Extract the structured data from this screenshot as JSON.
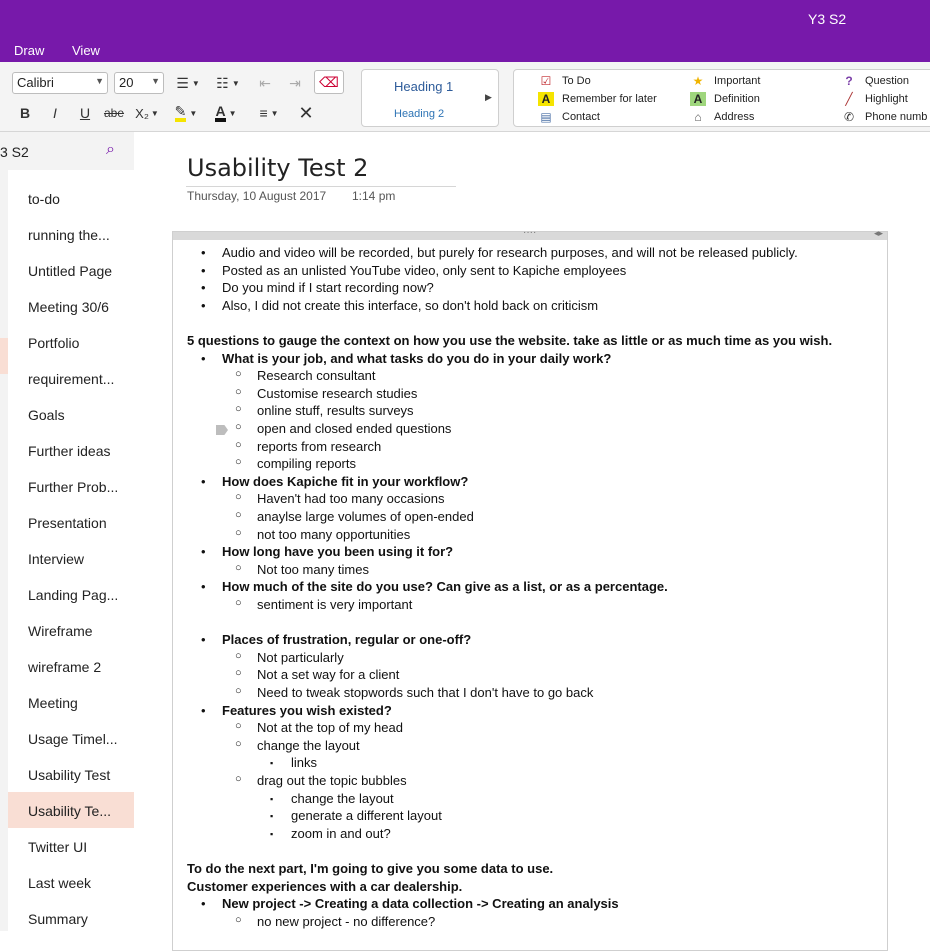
{
  "window": {
    "title": "Y3 S2"
  },
  "menu": {
    "draw": "Draw",
    "view": "View"
  },
  "ribbon": {
    "font_name": "Calibri",
    "font_size": "20",
    "bold": "B",
    "italic": "I",
    "underline": "U",
    "strike": "abe",
    "subscript": "X₂",
    "highlight_color": "#f5e400",
    "font_color": "#111111",
    "styles": {
      "heading1": "Heading 1",
      "heading2": "Heading 2"
    },
    "tags": {
      "todo": "To Do",
      "remember": "Remember for later",
      "contact": "Contact",
      "important": "Important",
      "definition": "Definition",
      "address": "Address",
      "question": "Question",
      "highlight": "Highlight",
      "phone": "Phone numb"
    }
  },
  "sidebar": {
    "notebook": "3 S2",
    "pages": [
      "to-do",
      "running the...",
      "Untitled Page",
      "Meeting 30/6",
      "Portfolio",
      "requirement...",
      "Goals",
      "Further ideas",
      "Further Prob...",
      "Presentation",
      "Interview",
      "Landing Pag...",
      "Wireframe",
      "wireframe 2",
      "Meeting",
      "Usage Timel...",
      "Usability Test",
      "Usability Te...",
      "Twitter UI",
      "Last week",
      "Summary"
    ],
    "selected_index": 17
  },
  "page": {
    "title": "Usability Test 2",
    "date": "Thursday, 10 August 2017",
    "time": "1:14 pm",
    "lines": [
      {
        "level": 1,
        "bold": false,
        "text": "Audio and video will be recorded, but purely for research purposes, and will not be released publicly."
      },
      {
        "level": 1,
        "bold": false,
        "text": "Posted as an unlisted YouTube video, only sent to Kapiche employees"
      },
      {
        "level": 1,
        "bold": false,
        "text": "Do you mind if I start recording now?"
      },
      {
        "level": 1,
        "bold": false,
        "text": "Also, I did not create this interface, so don't hold back on criticism"
      },
      {
        "level": 0,
        "bold": false,
        "text": ""
      },
      {
        "level": 0,
        "bold": true,
        "text": "5 questions to gauge the context on how you use the website. take as little or as much time as you wish."
      },
      {
        "level": 1,
        "bold": true,
        "text": "What is your job, and what tasks do you do in your daily work?"
      },
      {
        "level": 2,
        "bold": false,
        "text": "Research consultant"
      },
      {
        "level": 2,
        "bold": false,
        "text": "Customise research studies"
      },
      {
        "level": 2,
        "bold": false,
        "text": "online stuff, results surveys"
      },
      {
        "level": 2,
        "bold": false,
        "text": "open and closed ended questions"
      },
      {
        "level": 2,
        "bold": false,
        "text": "reports from research"
      },
      {
        "level": 2,
        "bold": false,
        "text": "compiling reports"
      },
      {
        "level": 1,
        "bold": true,
        "text": "How does Kapiche fit in your workflow?"
      },
      {
        "level": 2,
        "bold": false,
        "text": "Haven't had too many occasions"
      },
      {
        "level": 2,
        "bold": false,
        "text": "anaylse large volumes of open-ended"
      },
      {
        "level": 2,
        "bold": false,
        "text": "not too many opportunities"
      },
      {
        "level": 1,
        "bold": true,
        "text": "How long have you been using it for?"
      },
      {
        "level": 2,
        "bold": false,
        "text": "Not too many times"
      },
      {
        "level": 1,
        "bold": true,
        "text": "How much of the site do you use? Can give as a list, or as a percentage."
      },
      {
        "level": 2,
        "bold": false,
        "text": "sentiment is very important"
      },
      {
        "level": 0,
        "bold": false,
        "text": ""
      },
      {
        "level": 1,
        "bold": true,
        "text": "Places of frustration, regular or one-off?"
      },
      {
        "level": 2,
        "bold": false,
        "text": "Not particularly"
      },
      {
        "level": 2,
        "bold": false,
        "text": "Not a set way for a client"
      },
      {
        "level": 2,
        "bold": false,
        "text": "Need to tweak stopwords such that I don't have to go back"
      },
      {
        "level": 1,
        "bold": true,
        "text": "Features you wish existed?"
      },
      {
        "level": 2,
        "bold": false,
        "text": "Not at the top of my head"
      },
      {
        "level": 2,
        "bold": false,
        "text": "change the layout"
      },
      {
        "level": 3,
        "bold": false,
        "text": "links"
      },
      {
        "level": 2,
        "bold": false,
        "text": "drag out the topic bubbles"
      },
      {
        "level": 3,
        "bold": false,
        "text": "change the layout"
      },
      {
        "level": 3,
        "bold": false,
        "text": "generate a different layout"
      },
      {
        "level": 3,
        "bold": false,
        "text": "zoom in and out?"
      },
      {
        "level": 0,
        "bold": false,
        "text": ""
      },
      {
        "level": 0,
        "bold": true,
        "text": "To do the next part, I'm going to give you some data to use."
      },
      {
        "level": 0,
        "bold": true,
        "text": "Customer experiences with a car dealership."
      },
      {
        "level": 1,
        "bold": true,
        "text": "New project -> Creating a data collection -> Creating an analysis"
      },
      {
        "level": 2,
        "bold": false,
        "text": "no new project - no difference?"
      }
    ]
  }
}
